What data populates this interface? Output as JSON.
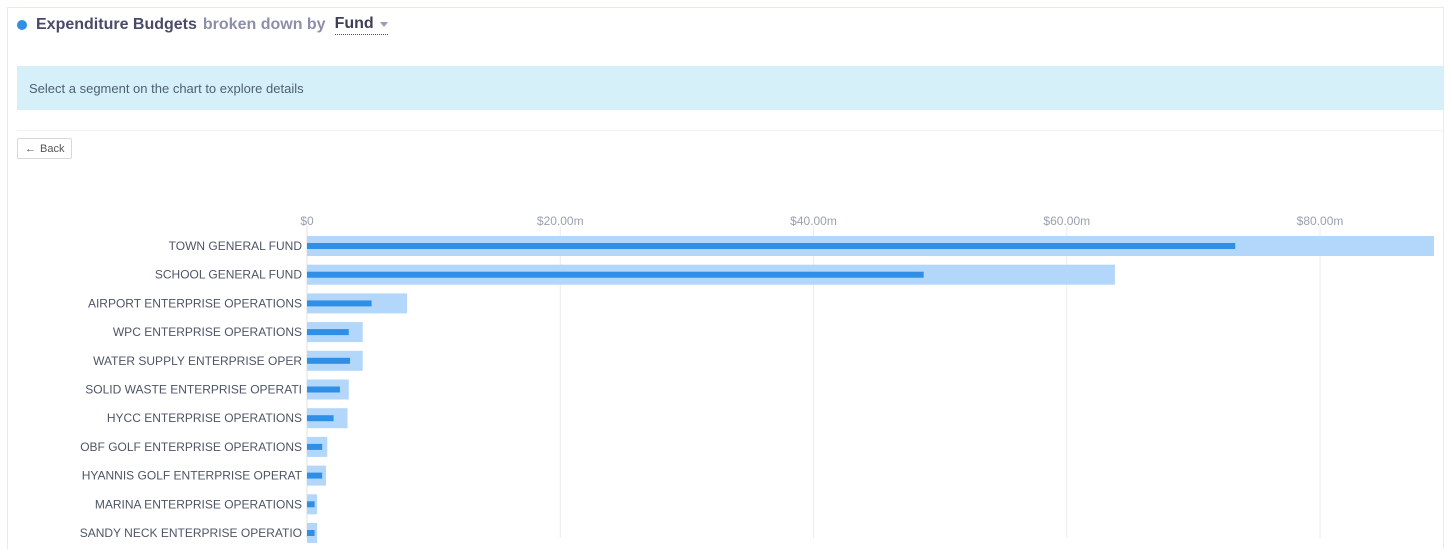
{
  "header": {
    "title": "Expenditure Budgets",
    "broken_down_by": "broken down by",
    "dimension": "Fund"
  },
  "info": {
    "text": "Select a segment on the chart to explore details"
  },
  "back_button": {
    "label": "Back",
    "icon": "arrow-left-icon"
  },
  "colors": {
    "budget_bar": "#b3d6fb",
    "actual_bar": "#2f8fe6",
    "accent": "#2f8fe6",
    "info_bg": "#d6f0fa"
  },
  "chart_data": {
    "type": "bar",
    "orientation": "horizontal",
    "xlim": [
      0,
      89
    ],
    "ticks": [
      {
        "value": 0,
        "label": "$0"
      },
      {
        "value": 20,
        "label": "$20.00m"
      },
      {
        "value": 40,
        "label": "$40.00m"
      },
      {
        "value": 60,
        "label": "$60.00m"
      },
      {
        "value": 80,
        "label": "$80.00m"
      }
    ],
    "categories": [
      "TOWN GENERAL FUND",
      "SCHOOL GENERAL FUND",
      "AIRPORT ENTERPRISE OPERATIONS",
      "WPC ENTERPRISE OPERATIONS",
      "WATER SUPPLY ENTERPRISE OPER",
      "SOLID WASTE ENTERPRISE OPERATI",
      "HYCC ENTERPRISE OPERATIONS",
      "OBF GOLF ENTERPRISE OPERATIONS",
      "HYANNIS GOLF ENTERPRISE OPERAT",
      "MARINA ENTERPRISE OPERATIONS",
      "SANDY NECK ENTERPRISE OPERATIO"
    ],
    "series": [
      {
        "values": [
          89.0,
          63.8,
          7.9,
          4.4,
          4.4,
          3.3,
          3.2,
          1.6,
          1.5,
          0.8,
          0.8
        ]
      },
      {
        "values": [
          73.3,
          48.7,
          5.1,
          3.3,
          3.4,
          2.6,
          2.1,
          1.2,
          1.2,
          0.6,
          0.6
        ]
      }
    ],
    "grid": true
  }
}
